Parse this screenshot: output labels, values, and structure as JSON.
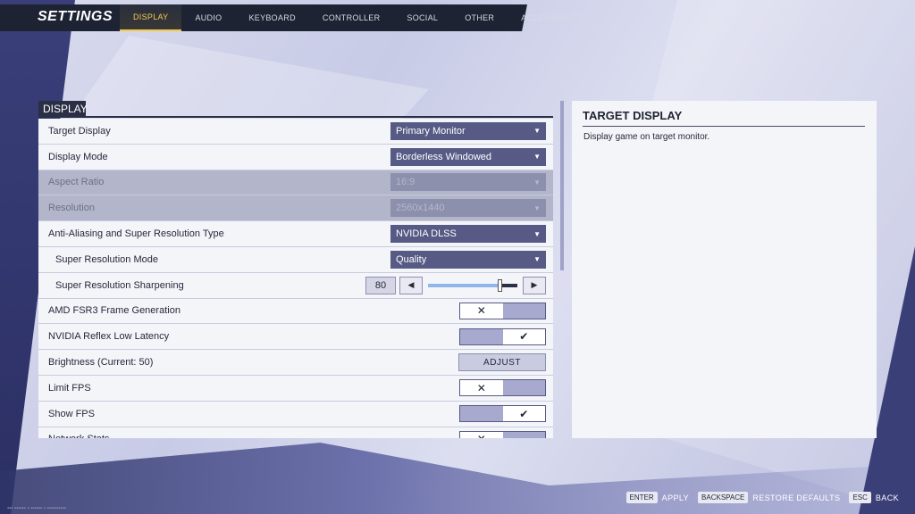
{
  "app_title": "SETTINGS",
  "tabs": [
    "DISPLAY",
    "AUDIO",
    "KEYBOARD",
    "CONTROLLER",
    "SOCIAL",
    "OTHER",
    "ACCESSIBILITY"
  ],
  "active_tab": "DISPLAY",
  "section": {
    "header": "DISPLAY",
    "rows": [
      {
        "label": "Target Display",
        "control": "dropdown",
        "value": "Primary Monitor"
      },
      {
        "label": "Display Mode",
        "control": "dropdown",
        "value": "Borderless Windowed"
      },
      {
        "label": "Aspect Ratio",
        "control": "dropdown",
        "value": "16:9",
        "disabled": true
      },
      {
        "label": "Resolution",
        "control": "dropdown",
        "value": "2560x1440",
        "disabled": true
      },
      {
        "label": "Anti-Aliasing and Super Resolution Type",
        "control": "dropdown",
        "value": "NVIDIA DLSS"
      },
      {
        "label": "Super Resolution Mode",
        "control": "dropdown",
        "value": "Quality",
        "sub": true
      },
      {
        "label": "Super Resolution Sharpening",
        "control": "slider",
        "value": "80",
        "fraction": 0.8,
        "sub": true
      },
      {
        "label": "AMD FSR3 Frame Generation",
        "control": "toggle",
        "checked": false
      },
      {
        "label": "NVIDIA Reflex Low Latency",
        "control": "toggle",
        "checked": true
      },
      {
        "label": "Brightness (Current: 50)",
        "control": "button",
        "value": "ADJUST"
      },
      {
        "label": "Limit FPS",
        "control": "toggle",
        "checked": false
      },
      {
        "label": "Show FPS",
        "control": "toggle",
        "checked": true
      },
      {
        "label": "Network Stats",
        "control": "toggle",
        "checked": false
      }
    ]
  },
  "info": {
    "title": "TARGET DISPLAY",
    "description": "Display game on target monitor."
  },
  "hints": [
    {
      "key": "ENTER",
      "label": "APPLY"
    },
    {
      "key": "BACKSPACE",
      "label": "RESTORE DEFAULTS"
    },
    {
      "key": "ESC",
      "label": "BACK"
    }
  ],
  "colors": {
    "accent": "#f2c94c",
    "nav_bg": "#1e2333",
    "dropdown_bg": "#565a84",
    "panel_bg": "#f4f5f9"
  },
  "icons": {
    "dropdown_arrow": "caret-down-icon",
    "check": "check-icon",
    "cross": "cross-icon",
    "left": "arrow-left-icon",
    "right": "arrow-right-icon"
  }
}
